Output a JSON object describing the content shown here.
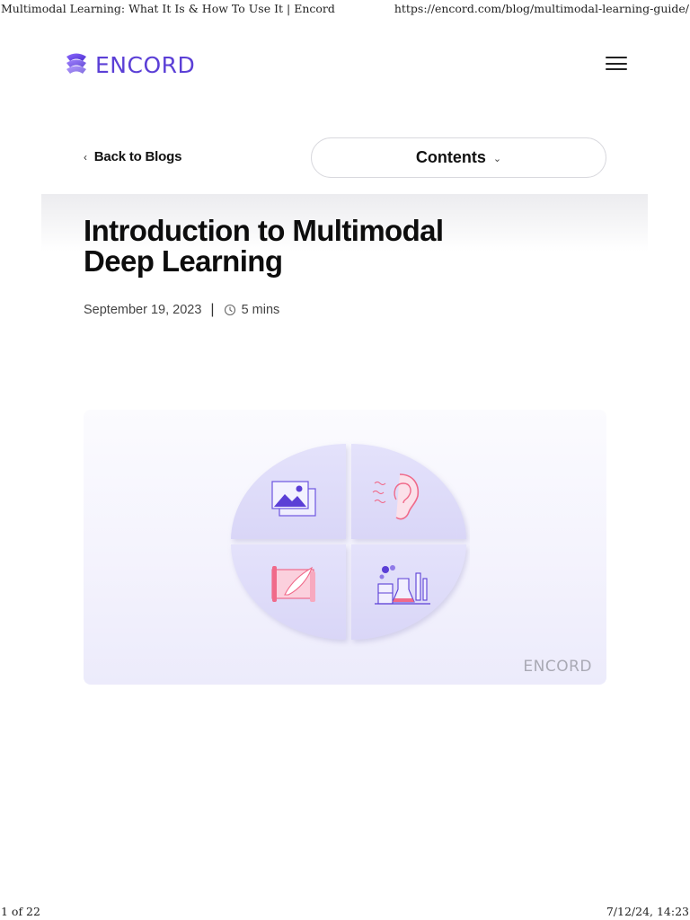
{
  "print": {
    "title": "Multimodal Learning: What It Is & How To Use It | Encord",
    "url": "https://encord.com/blog/multimodal-learning-guide/",
    "page": "1 of 22",
    "timestamp": "7/12/24, 14:23"
  },
  "nav": {
    "logo_text": "ENCORD",
    "menu_icon": "hamburger-icon"
  },
  "toolbar": {
    "back_label": "Back to Blogs",
    "contents_label": "Contents"
  },
  "article": {
    "title": "Introduction to Multimodal Deep Learning",
    "date": "September 19, 2023",
    "separator": "|",
    "read_time": "5 mins"
  },
  "hero": {
    "watermark": "ENCORD",
    "quadrant_icons": [
      "image-icon",
      "ear-icon",
      "scroll-quill-icon",
      "lab-equipment-icon"
    ]
  },
  "colors": {
    "brand": "#5b3fd6",
    "accent_pink": "#f06a8a",
    "hero_bg": "#f1f0fc"
  }
}
